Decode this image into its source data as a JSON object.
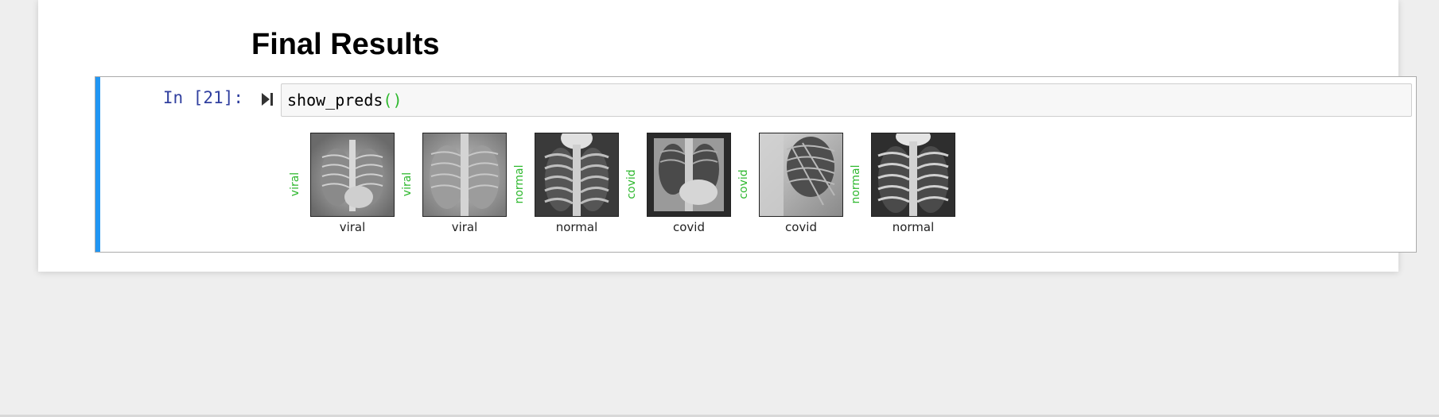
{
  "heading": "Final Results",
  "cell": {
    "prompt": "In [21]:",
    "code_fn": "show_preds",
    "code_parens": "()",
    "accent_color": "#2196f3"
  },
  "predictions": [
    {
      "predicted": "viral",
      "actual": "viral"
    },
    {
      "predicted": "viral",
      "actual": "viral"
    },
    {
      "predicted": "normal",
      "actual": "normal"
    },
    {
      "predicted": "covid",
      "actual": "covid"
    },
    {
      "predicted": "covid",
      "actual": "covid"
    },
    {
      "predicted": "normal",
      "actual": "normal"
    }
  ],
  "colors": {
    "correct_prediction": "#2eb82e",
    "prompt": "#303f9f"
  },
  "icons": {
    "run": "run-cell-icon"
  }
}
